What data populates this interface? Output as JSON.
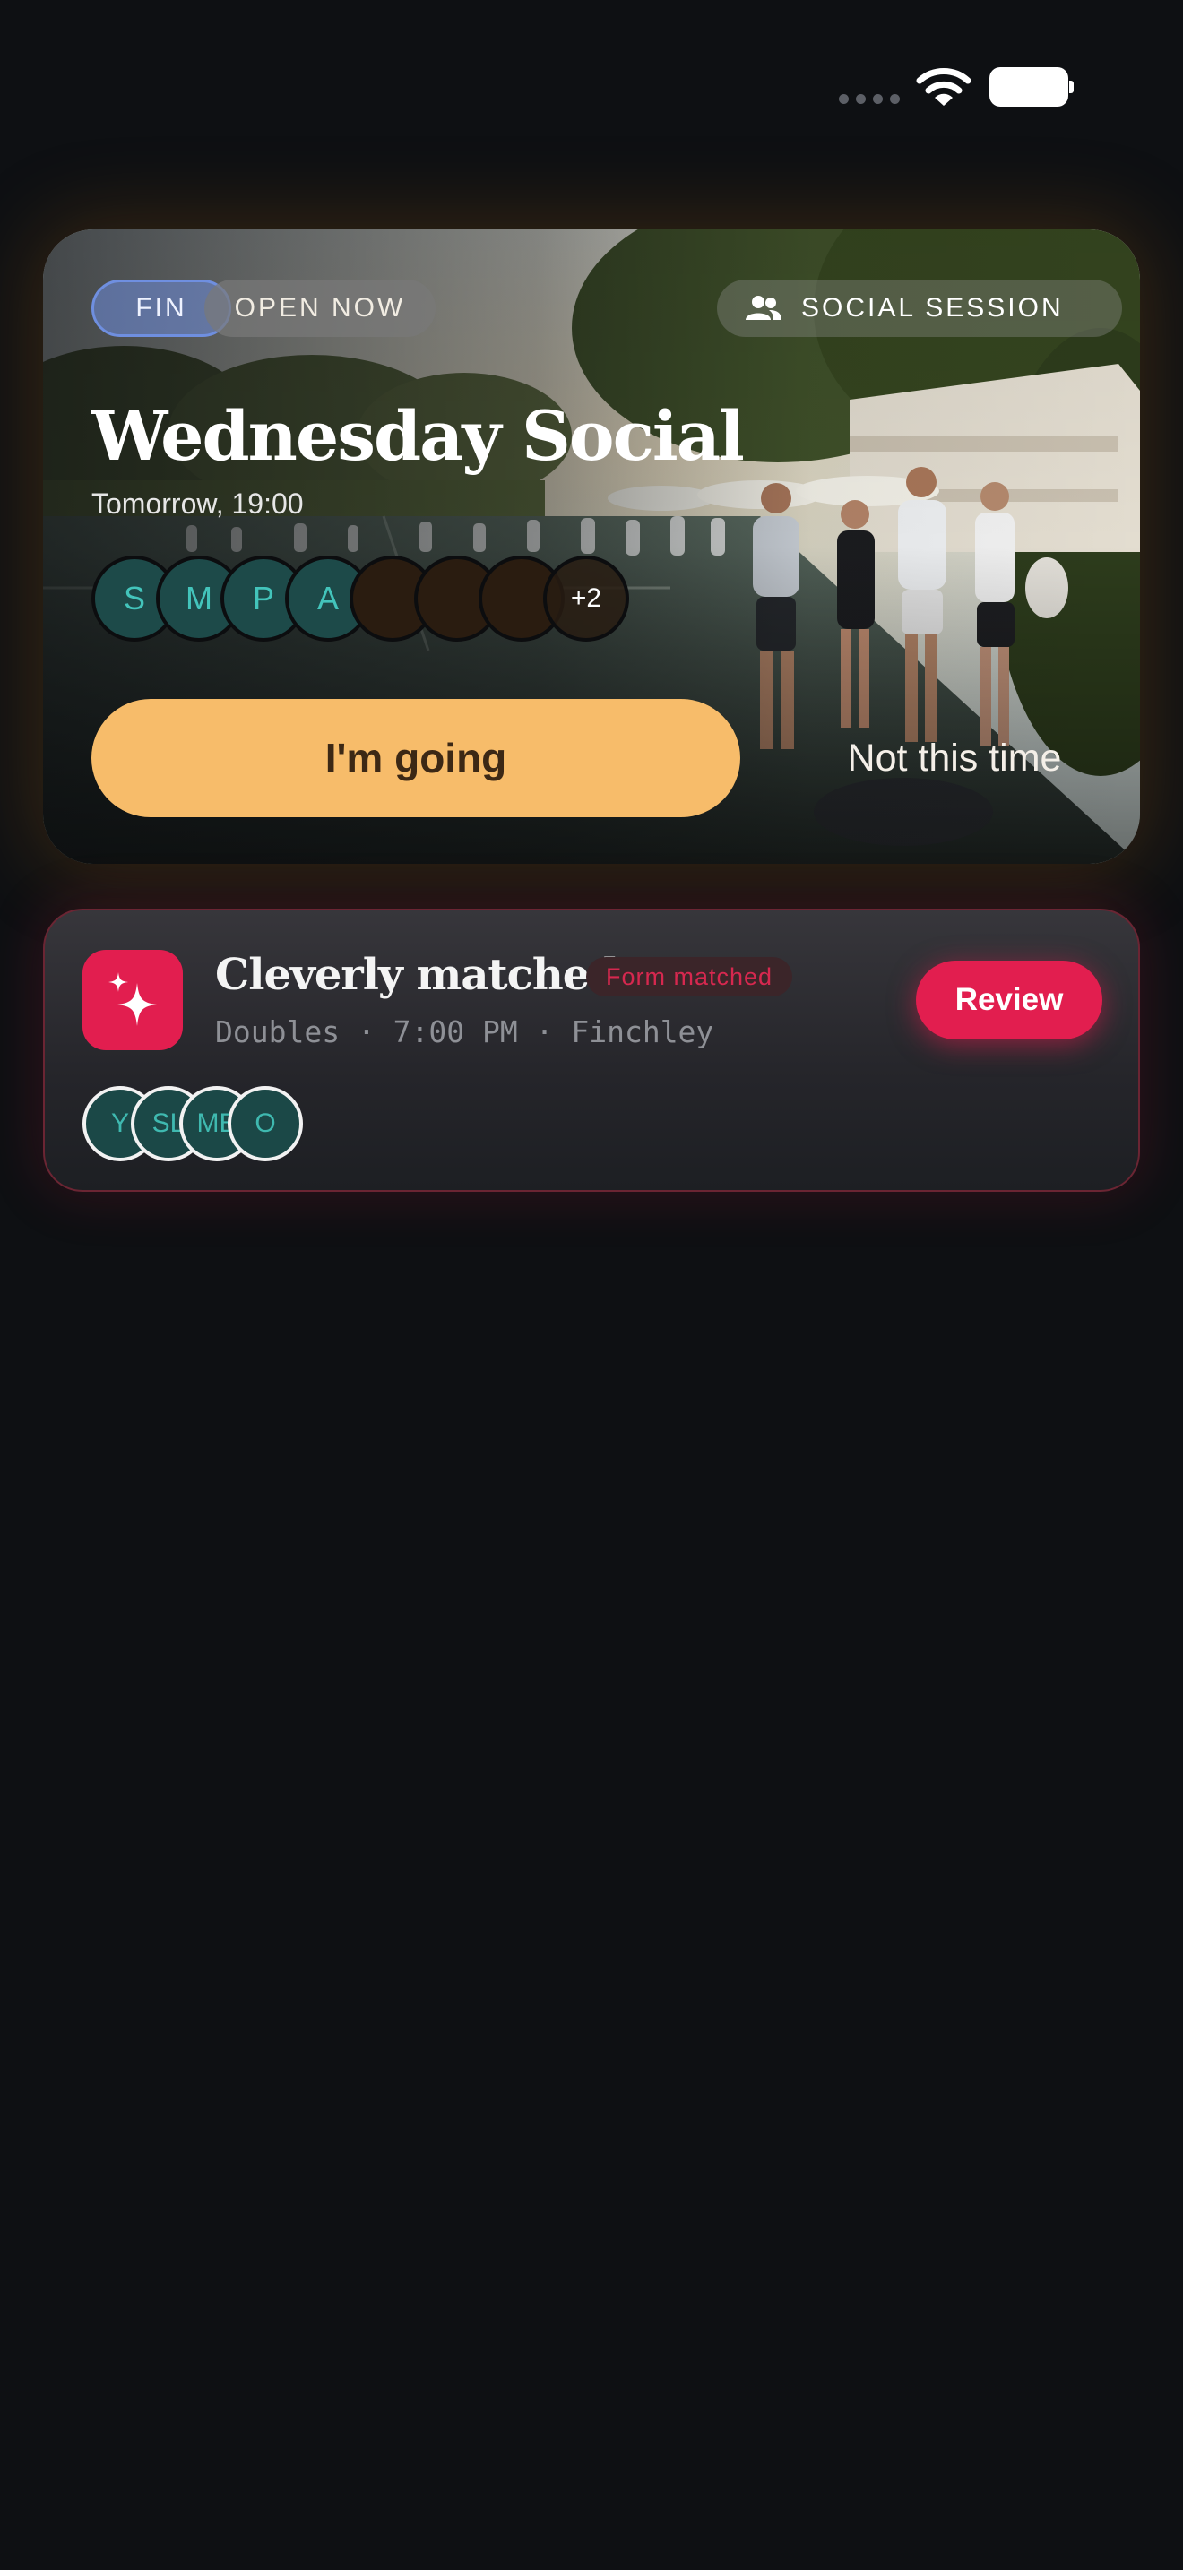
{
  "status_bar": {
    "icons": [
      "signal-dots-icon",
      "wifi-icon",
      "battery-icon"
    ]
  },
  "social_card": {
    "chips": {
      "fin": "FIN",
      "open": "OPEN NOW",
      "session": "SOCIAL SESSION",
      "session_icon": "people-icon"
    },
    "title": "Wednesday Social",
    "subtitle": "Tomorrow, 19:00",
    "attendee_initials": [
      "S",
      "M",
      "P",
      "A"
    ],
    "photo_avatar_count": 3,
    "more_count": "+2",
    "going_label": "I'm going",
    "decline_label": "Not this time",
    "colors": {
      "going_button": "#f7bc6a",
      "avatar_bg": "#1d4a49",
      "avatar_text": "#43c4bb"
    }
  },
  "match_card": {
    "icon": "sparkle-icon",
    "title": "Cleverly matched",
    "badge": "Form matched",
    "meta": "Doubles · 7:00 PM · Finchley",
    "review_label": "Review",
    "players": [
      "Y",
      "SL",
      "MB",
      "O"
    ],
    "colors": {
      "accent": "#e21e4f",
      "badge_text": "#d6284f"
    }
  }
}
